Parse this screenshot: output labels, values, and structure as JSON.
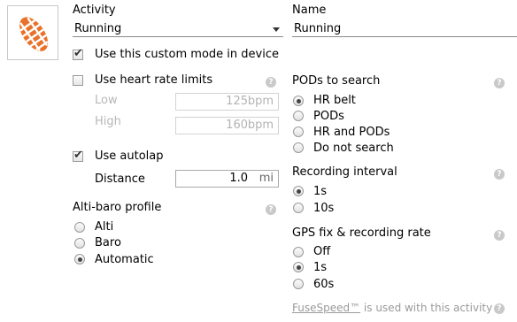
{
  "activity": {
    "label": "Activity",
    "selected": "Running"
  },
  "name": {
    "label": "Name",
    "value": "Running"
  },
  "custom_mode": {
    "label": "Use this custom mode in device",
    "checked": true
  },
  "heart_rate": {
    "label": "Use heart rate limits",
    "checked": false,
    "low": {
      "label": "Low",
      "value": "125",
      "unit": "bpm"
    },
    "high": {
      "label": "High",
      "value": "160",
      "unit": "bpm"
    }
  },
  "autolap": {
    "label": "Use autolap",
    "checked": true,
    "distance": {
      "label": "Distance",
      "value": "1.0",
      "unit": "mi"
    }
  },
  "alti_baro": {
    "label": "Alti-baro profile",
    "options": [
      {
        "label": "Alti",
        "selected": false
      },
      {
        "label": "Baro",
        "selected": false
      },
      {
        "label": "Automatic",
        "selected": true
      }
    ]
  },
  "pods": {
    "label": "PODs to search",
    "options": [
      {
        "label": "HR belt",
        "selected": true
      },
      {
        "label": "PODs",
        "selected": false
      },
      {
        "label": "HR and PODs",
        "selected": false
      },
      {
        "label": "Do not search",
        "selected": false
      }
    ]
  },
  "recording_interval": {
    "label": "Recording interval",
    "options": [
      {
        "label": "1s",
        "selected": true
      },
      {
        "label": "10s",
        "selected": false
      }
    ]
  },
  "gps": {
    "label": "GPS fix & recording rate",
    "options": [
      {
        "label": "Off",
        "selected": false
      },
      {
        "label": "1s",
        "selected": true
      },
      {
        "label": "60s",
        "selected": false
      }
    ]
  },
  "fusespeed": {
    "link": "FuseSpeed™",
    "text": " is used with this activity"
  },
  "help_glyph": "?",
  "check_glyph": "✔",
  "icons": {
    "activity": "running-shoe-icon",
    "help": "help-icon"
  },
  "colors": {
    "accent": "#e8722a",
    "disabled": "#b7b7b7"
  }
}
